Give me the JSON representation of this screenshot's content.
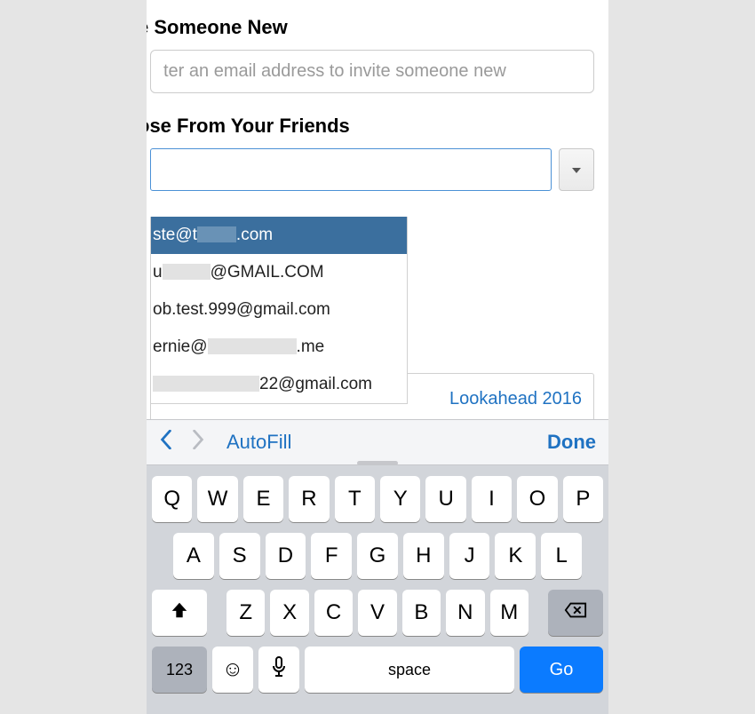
{
  "sections": {
    "invite_heading": "e Someone New",
    "email_placeholder": "ter an email address to invite someone new",
    "friends_heading": "ose From Your Friends"
  },
  "dropdown": {
    "items": [
      {
        "prefix": "ste@t",
        "redact_w": 44,
        "suffix": ".com",
        "selected": true
      },
      {
        "prefix": "u",
        "redact_w": 54,
        "suffix": "@GMAIL.COM",
        "selected": false
      },
      {
        "prefix": "ob.test.999@gmail.com",
        "redact_w": 0,
        "suffix": "",
        "selected": false
      },
      {
        "prefix": "ernie@",
        "redact_w": 100,
        "suffix": ".me",
        "selected": false
      },
      {
        "prefix": "",
        "redact_w": 120,
        "suffix": "22@gmail.com",
        "selected": false
      }
    ]
  },
  "link": {
    "lookahead": "Lookahead 2016"
  },
  "accessory": {
    "autofill": "AutoFill",
    "done": "Done"
  },
  "keyboard": {
    "row1": [
      "Q",
      "W",
      "E",
      "R",
      "T",
      "Y",
      "U",
      "I",
      "O",
      "P"
    ],
    "row2": [
      "A",
      "S",
      "D",
      "F",
      "G",
      "H",
      "J",
      "K",
      "L"
    ],
    "row3": [
      "Z",
      "X",
      "C",
      "V",
      "B",
      "N",
      "M"
    ],
    "k123": "123",
    "space": "space",
    "go": "Go"
  }
}
